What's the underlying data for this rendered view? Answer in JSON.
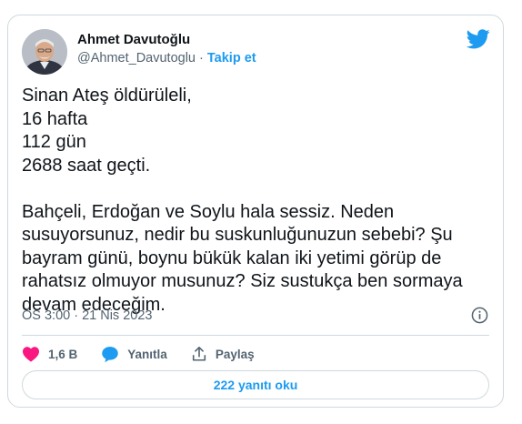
{
  "author": {
    "name": "Ahmet Davutoğlu",
    "handle": "@Ahmet_Davutoglu",
    "separator": " · ",
    "follow_label": "Takip et"
  },
  "tweet": {
    "text": "Sinan Ateş öldürüleli,\n16 hafta\n112 gün\n2688 saat geçti.\n\nBahçeli, Erdoğan ve Soylu hala sessiz. Neden susuyorsunuz, nedir bu suskunluğunuzun sebebi? Şu bayram günü, boynu bükük kalan iki yetimi görüp de rahatsız olmuyor musunuz? Siz sustukça ben sormaya devam edeceğim.",
    "timestamp": "ÖS 3:00 · 21 Nis 2023"
  },
  "actions": {
    "like_count": "1,6 B",
    "reply_label": "Yanıtla",
    "share_label": "Paylaş"
  },
  "replies_button": "222 yanıtı oku",
  "colors": {
    "accent": "#1d9bf0",
    "like": "#f91880",
    "text": "#0f1419",
    "muted": "#536471",
    "border": "#cfd9de"
  },
  "icons": [
    "twitter-bird-icon",
    "info-icon",
    "heart-icon",
    "reply-bubble-icon",
    "share-icon"
  ]
}
